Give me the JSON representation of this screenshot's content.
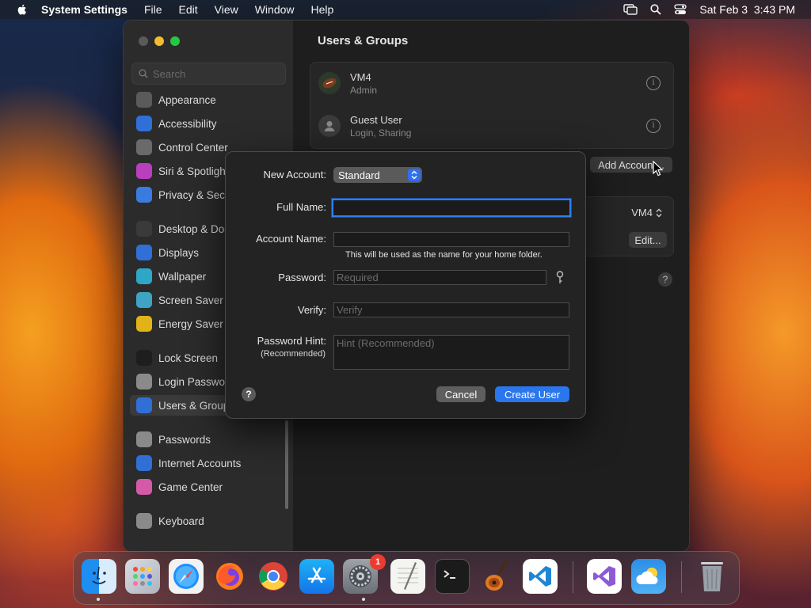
{
  "menubar": {
    "app": "System Settings",
    "items": [
      "File",
      "Edit",
      "View",
      "Window",
      "Help"
    ],
    "clock": "Sat Feb 3  3:43 PM"
  },
  "sidebar": {
    "search_placeholder": "Search",
    "items": [
      {
        "label": "Appearance",
        "icon": "appearance-icon",
        "color": "#5a5a5a"
      },
      {
        "label": "Accessibility",
        "icon": "accessibility-icon",
        "color": "#2f6fd6"
      },
      {
        "label": "Control Center",
        "icon": "control-center-icon",
        "color": "#6a6a6a"
      },
      {
        "label": "Siri & Spotlight",
        "icon": "siri-icon",
        "color": "#b93fbf"
      },
      {
        "label": "Privacy & Security",
        "icon": "privacy-hand-icon",
        "color": "#3a7be0"
      },
      {
        "label": "Desktop & Dock",
        "icon": "desktop-dock-icon",
        "color": "#3a3a3a"
      },
      {
        "label": "Displays",
        "icon": "displays-icon",
        "color": "#2f6fd6"
      },
      {
        "label": "Wallpaper",
        "icon": "wallpaper-icon",
        "color": "#2ea7c7"
      },
      {
        "label": "Screen Saver",
        "icon": "screen-saver-icon",
        "color": "#3fa3c3"
      },
      {
        "label": "Energy Saver",
        "icon": "energy-saver-icon",
        "color": "#e0b418"
      },
      {
        "label": "Lock Screen",
        "icon": "lock-screen-icon",
        "color": "#1e1e1e"
      },
      {
        "label": "Login Password",
        "icon": "login-password-icon",
        "color": "#8a8a8a"
      },
      {
        "label": "Users & Groups",
        "icon": "users-groups-icon",
        "color": "#2f6fd6"
      },
      {
        "label": "Passwords",
        "icon": "passwords-key-icon",
        "color": "#8a8a8a"
      },
      {
        "label": "Internet Accounts",
        "icon": "internet-accounts-icon",
        "color": "#2f6fd6"
      },
      {
        "label": "Game Center",
        "icon": "game-center-icon",
        "color": "#d45aa8"
      },
      {
        "label": "Keyboard",
        "icon": "keyboard-icon",
        "color": "#8a8a8a"
      }
    ]
  },
  "content": {
    "title": "Users & Groups",
    "users": [
      {
        "name": "VM4",
        "role": "Admin"
      },
      {
        "name": "Guest User",
        "role": "Login, Sharing"
      }
    ],
    "add_account_label": "Add Account...",
    "auto_login_user": "VM4",
    "edit_label": "Edit...",
    "help": "?"
  },
  "dialog": {
    "new_account_label": "New Account:",
    "account_type": "Standard",
    "full_name_label": "Full Name:",
    "full_name_value": "",
    "account_name_label": "Account Name:",
    "account_name_value": "",
    "account_name_hint": "This will be used as the name for your home folder.",
    "password_label": "Password:",
    "password_placeholder": "Required",
    "verify_label": "Verify:",
    "verify_placeholder": "Verify",
    "hint_label": "Password Hint:",
    "hint_label_sub": "(Recommended)",
    "hint_placeholder": "Hint (Recommended)",
    "help": "?",
    "cancel_label": "Cancel",
    "create_label": "Create User"
  },
  "dock": {
    "apps": [
      "Finder",
      "Launchpad",
      "Safari",
      "Firefox",
      "Chrome",
      "App Store",
      "System Settings",
      "TextEdit",
      "Terminal",
      "GarageBand",
      "Visual Studio Code",
      "Visual Studio",
      "Weather",
      "Trash"
    ],
    "settings_badge": "1"
  }
}
